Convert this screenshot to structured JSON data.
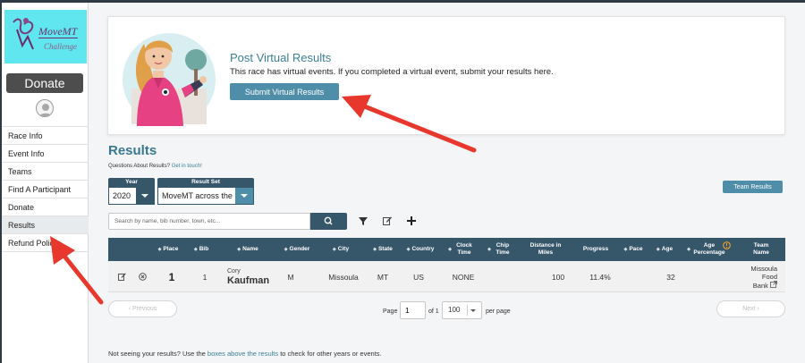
{
  "sidebar": {
    "logo_text": "MoveMT",
    "logo_subtext": "Challenge",
    "donate_label": "Donate",
    "items": [
      {
        "label": "Race Info"
      },
      {
        "label": "Event Info"
      },
      {
        "label": "Teams"
      },
      {
        "label": "Find A Participant"
      },
      {
        "label": "Donate"
      },
      {
        "label": "Results",
        "active": true
      },
      {
        "label": "Refund Policy"
      }
    ]
  },
  "virtual": {
    "title": "Post Virtual Results",
    "text": "This race has virtual events. If you completed a virtual event, submit your results here.",
    "button_label": "Submit Virtual Results"
  },
  "results": {
    "title": "Results",
    "questions_text": "Questions About Results?",
    "questions_link": "Get in touch!",
    "year_label": "Year",
    "year_value": "2020",
    "result_set_label": "Result Set",
    "result_set_value": "MoveMT across the",
    "team_results_label": "Team Results",
    "search_placeholder": "Search by name, bib number, town, etc...",
    "columns": {
      "place": "Place",
      "bib": "Bib",
      "name": "Name",
      "gender": "Gender",
      "city": "City",
      "state": "State",
      "country": "Country",
      "clock_time": "Clock Time",
      "chip_time": "Chip Time",
      "distance": "Distance in Miles",
      "progress": "Progress",
      "pace": "Pace",
      "age": "Age",
      "age_pct": "Age Percentage",
      "team": "Team Name"
    },
    "rows": [
      {
        "place": "1",
        "bib": "1",
        "first_name": "Cory",
        "last_name": "Kaufman",
        "gender": "M",
        "city": "Missoula",
        "state": "MT",
        "country": "US",
        "clock_time": "NONE",
        "distance": "100",
        "progress": "11.4%",
        "age": "32",
        "team_line1": "Missoula",
        "team_line2": "Food",
        "team_line3": "Bank"
      }
    ]
  },
  "pagination": {
    "prev_label": "‹ Previous",
    "next_label": "Next ›",
    "page_label": "Page",
    "page_value": "1",
    "of_label": "of 1",
    "per_page_value": "100",
    "per_page_label": "per page"
  },
  "footer": {
    "text_before": "Not seeing your results? Use the",
    "link": "boxes above the results",
    "text_after": "to check for other years or events."
  },
  "colors": {
    "accent": "#4f8ea9",
    "header_dark": "#36566a",
    "arrow_red": "#e8382d",
    "logo_bg": "#5fe6ee"
  }
}
